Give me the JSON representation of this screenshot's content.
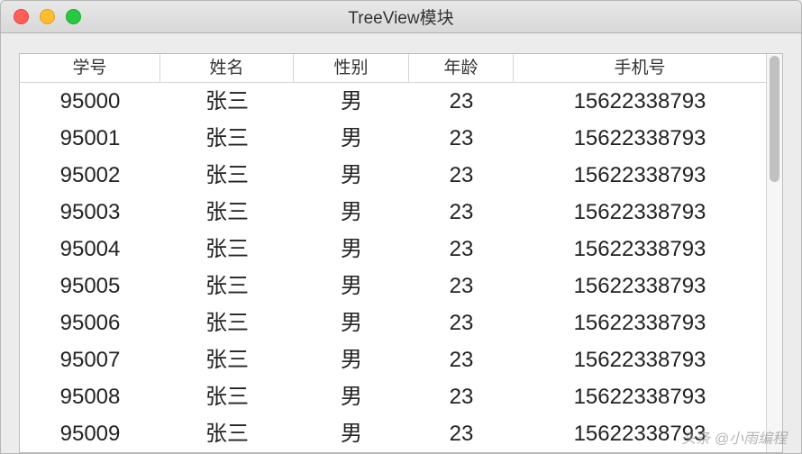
{
  "window": {
    "title": "TreeView模块"
  },
  "table": {
    "headers": [
      "学号",
      "姓名",
      "性别",
      "年龄",
      "手机号"
    ],
    "rows": [
      [
        "95000",
        "张三",
        "男",
        "23",
        "15622338793"
      ],
      [
        "95001",
        "张三",
        "男",
        "23",
        "15622338793"
      ],
      [
        "95002",
        "张三",
        "男",
        "23",
        "15622338793"
      ],
      [
        "95003",
        "张三",
        "男",
        "23",
        "15622338793"
      ],
      [
        "95004",
        "张三",
        "男",
        "23",
        "15622338793"
      ],
      [
        "95005",
        "张三",
        "男",
        "23",
        "15622338793"
      ],
      [
        "95006",
        "张三",
        "男",
        "23",
        "15622338793"
      ],
      [
        "95007",
        "张三",
        "男",
        "23",
        "15622338793"
      ],
      [
        "95008",
        "张三",
        "男",
        "23",
        "15622338793"
      ],
      [
        "95009",
        "张三",
        "男",
        "23",
        "15622338793"
      ]
    ]
  },
  "watermark": "头条 @小雨编程"
}
